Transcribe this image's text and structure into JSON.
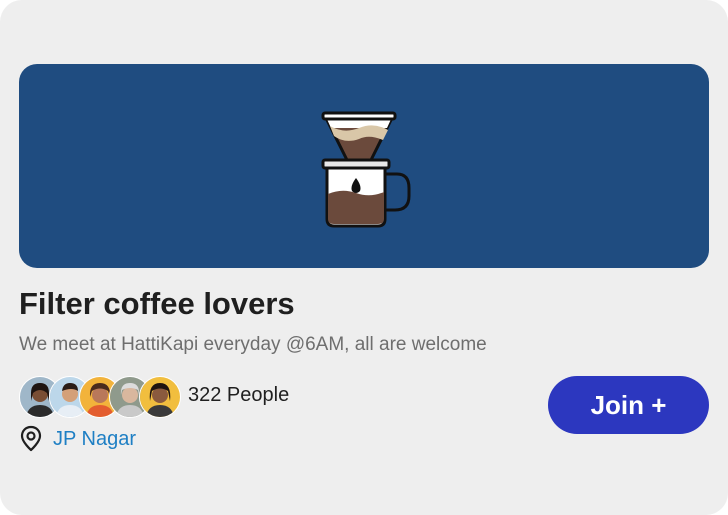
{
  "colors": {
    "card_background": "#eeeeee",
    "banner_background": "#1f4c80",
    "button_background": "#2c37bf",
    "location_text": "#1e7fc4"
  },
  "banner": {
    "icon": "coffee-filter-pot-icon"
  },
  "group": {
    "title": "Filter coffee lovers",
    "description": "We meet at HattiKapi everyday @6AM, all are welcome"
  },
  "members": {
    "avatar_count": 5,
    "count_label": "322 People"
  },
  "location": {
    "icon": "location-pin-icon",
    "name": "JP Nagar"
  },
  "actions": {
    "join_label": "Join +"
  }
}
